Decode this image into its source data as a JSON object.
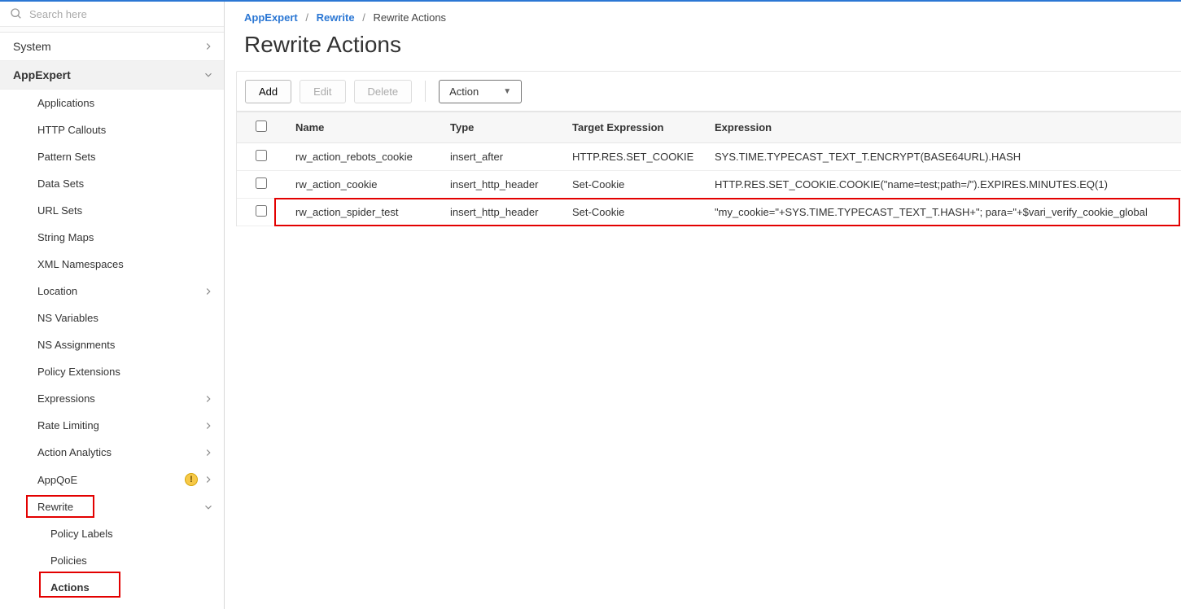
{
  "search": {
    "placeholder": "Search here"
  },
  "sidebar": {
    "items": [
      {
        "label": "System",
        "level": 1,
        "chev": "right"
      },
      {
        "label": "AppExpert",
        "level": 1,
        "expanded": true,
        "chev": "down"
      },
      {
        "label": "Applications",
        "level": 2
      },
      {
        "label": "HTTP Callouts",
        "level": 2
      },
      {
        "label": "Pattern Sets",
        "level": 2
      },
      {
        "label": "Data Sets",
        "level": 2
      },
      {
        "label": "URL Sets",
        "level": 2
      },
      {
        "label": "String Maps",
        "level": 2
      },
      {
        "label": "XML Namespaces",
        "level": 2
      },
      {
        "label": "Location",
        "level": 2,
        "chev": "right"
      },
      {
        "label": "NS Variables",
        "level": 2
      },
      {
        "label": "NS Assignments",
        "level": 2
      },
      {
        "label": "Policy Extensions",
        "level": 2
      },
      {
        "label": "Expressions",
        "level": 2,
        "chev": "right"
      },
      {
        "label": "Rate Limiting",
        "level": 2,
        "chev": "right"
      },
      {
        "label": "Action Analytics",
        "level": 2,
        "chev": "right"
      },
      {
        "label": "AppQoE",
        "level": 2,
        "chev": "right",
        "warn": true
      },
      {
        "label": "Rewrite",
        "level": 2,
        "chev": "down",
        "highlight": true
      },
      {
        "label": "Policy Labels",
        "level": 3
      },
      {
        "label": "Policies",
        "level": 3
      },
      {
        "label": "Actions",
        "level": 3,
        "active": true,
        "highlight": true
      }
    ]
  },
  "breadcrumbs": {
    "parts": [
      "AppExpert",
      "Rewrite",
      "Rewrite Actions"
    ]
  },
  "page": {
    "title": "Rewrite Actions"
  },
  "toolbar": {
    "add_label": "Add",
    "edit_label": "Edit",
    "delete_label": "Delete",
    "action_label": "Action"
  },
  "table": {
    "headers": {
      "name": "Name",
      "type": "Type",
      "target": "Target Expression",
      "expression": "Expression"
    },
    "rows": [
      {
        "name": "rw_action_rebots_cookie",
        "type": "insert_after",
        "target": "HTTP.RES.SET_COOKIE",
        "expression": "SYS.TIME.TYPECAST_TEXT_T.ENCRYPT(BASE64URL).HASH"
      },
      {
        "name": "rw_action_cookie",
        "type": "insert_http_header",
        "target": "Set-Cookie",
        "expression": "HTTP.RES.SET_COOKIE.COOKIE(\"name=test;path=/\").EXPIRES.MINUTES.EQ(1)"
      },
      {
        "name": "rw_action_spider_test",
        "type": "insert_http_header",
        "target": "Set-Cookie",
        "expression": "\"my_cookie=\"+SYS.TIME.TYPECAST_TEXT_T.HASH+\"; para=\"+$vari_verify_cookie_global",
        "highlight": true
      }
    ]
  }
}
